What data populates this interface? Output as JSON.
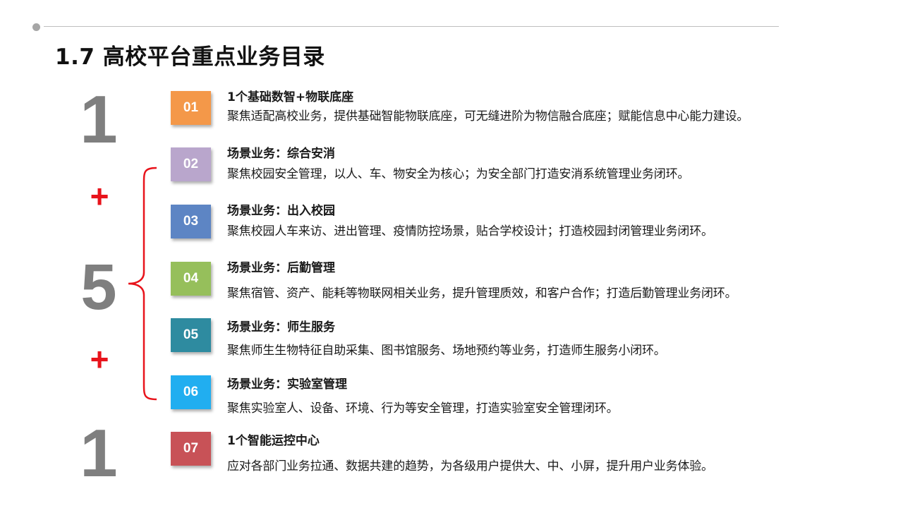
{
  "title": "1.7 高校平台重点业务目录",
  "formula": {
    "top": "1",
    "plus_top": "+",
    "middle": "5",
    "plus_bottom": "+",
    "bottom": "1"
  },
  "colors": {
    "accent_red": "#e8131b",
    "numeral_gray": "#7f7f7f",
    "badges": [
      "#f49849",
      "#b9a6cc",
      "#5d85c4",
      "#96bf5b",
      "#2e8ba0",
      "#21aef0",
      "#c85257"
    ]
  },
  "items": [
    {
      "num": "01",
      "title": "1个基础数智+物联底座",
      "desc": "聚焦适配高校业务，提供基础智能物联底座，可无缝进阶为物信融合底座；赋能信息中心能力建设。"
    },
    {
      "num": "02",
      "title": "场景业务：综合安消",
      "desc": "聚焦校园安全管理，以人、车、物安全为核心；为安全部门打造安消系统管理业务闭环。"
    },
    {
      "num": "03",
      "title": "场景业务：出入校园",
      "desc": "聚焦校园人车来访、进出管理、疫情防控场景，贴合学校设计；打造校园封闭管理业务闭环。"
    },
    {
      "num": "04",
      "title": "场景业务：后勤管理",
      "desc": "聚焦宿管、资产、能耗等物联网相关业务，提升管理质效，和客户合作；打造后勤管理业务闭环。"
    },
    {
      "num": "05",
      "title": "场景业务：师生服务",
      "desc": "聚焦师生生物特征自助采集、图书馆服务、场地预约等业务，打造师生服务小闭环。"
    },
    {
      "num": "06",
      "title": "场景业务：实验室管理",
      "desc": "聚焦实验室人、设备、环境、行为等安全管理，打造实验室安全管理闭环。"
    },
    {
      "num": "07",
      "title": "1个智能运控中心",
      "desc": "应对各部门业务拉通、数据共建的趋势，为各级用户提供大、中、小屏，提升用户业务体验。"
    }
  ]
}
